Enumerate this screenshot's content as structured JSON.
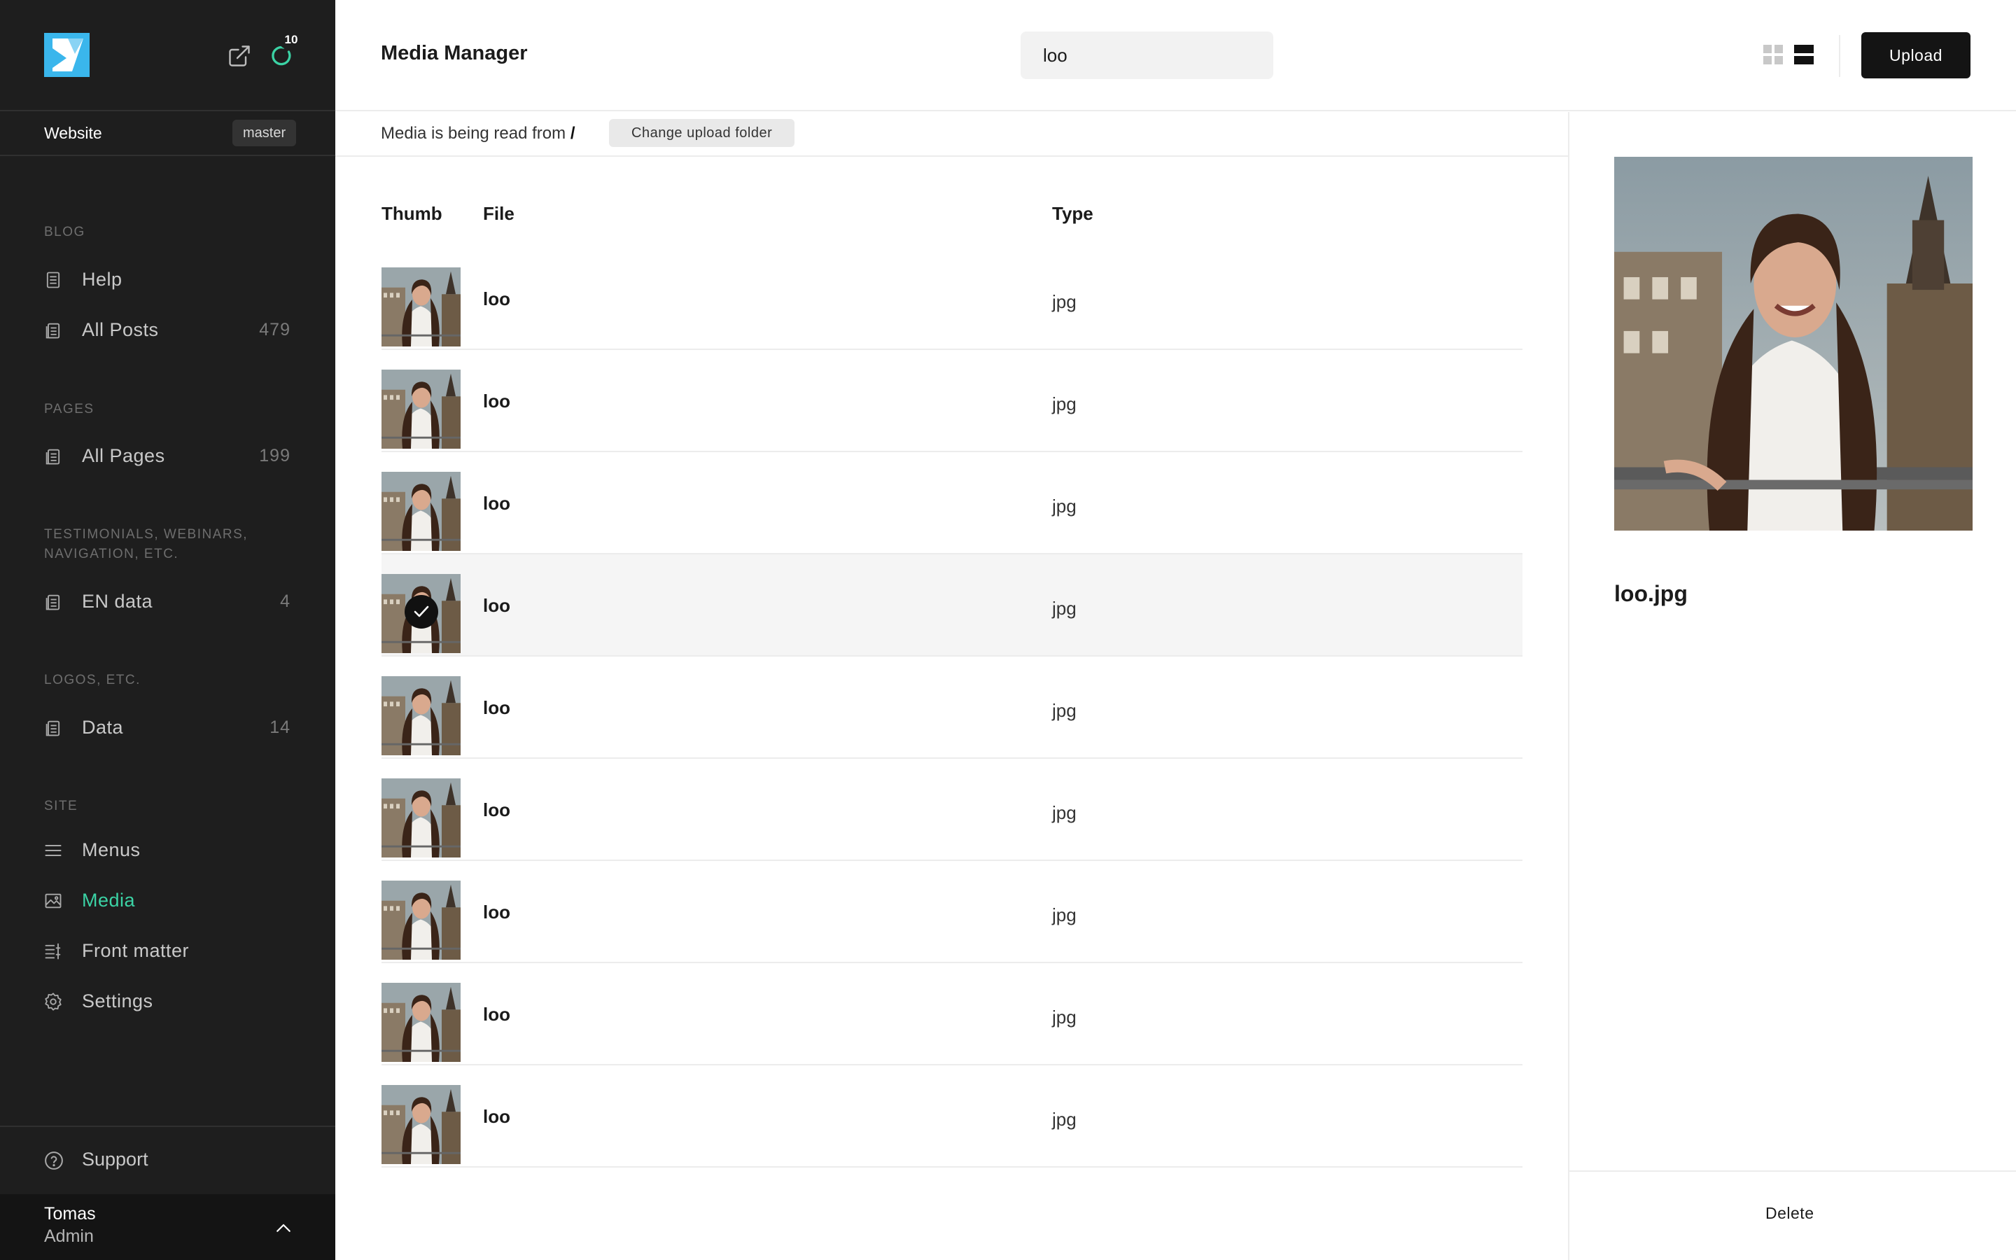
{
  "sidebar": {
    "sync_count": "10",
    "site_name": "Website",
    "branch": "master",
    "sections": [
      {
        "title": "BLOG",
        "items": [
          {
            "label": "Help",
            "count": "",
            "icon": "document-icon"
          },
          {
            "label": "All Posts",
            "count": "479",
            "icon": "documents-icon"
          }
        ]
      },
      {
        "title": "PAGES",
        "items": [
          {
            "label": "All Pages",
            "count": "199",
            "icon": "documents-icon"
          }
        ]
      },
      {
        "title": "TESTIMONIALS, WEBINARS, NAVIGATION, ETC.",
        "items": [
          {
            "label": "EN data",
            "count": "4",
            "icon": "documents-icon"
          }
        ]
      },
      {
        "title": "LOGOS, ETC.",
        "items": [
          {
            "label": "Data",
            "count": "14",
            "icon": "documents-icon"
          }
        ]
      },
      {
        "title": "SITE",
        "items": [
          {
            "label": "Menus",
            "icon": "menu-icon"
          },
          {
            "label": "Media",
            "icon": "image-icon",
            "active": true
          },
          {
            "label": "Front matter",
            "icon": "sliders-icon"
          },
          {
            "label": "Settings",
            "icon": "gear-icon"
          }
        ]
      }
    ],
    "support_label": "Support",
    "user": {
      "name": "Tomas",
      "role": "Admin"
    }
  },
  "header": {
    "title": "Media Manager",
    "search_value": "loo",
    "upload_label": "Upload"
  },
  "pathbar": {
    "prefix": "Media is being read from",
    "path": "/",
    "change_label": "Change upload folder"
  },
  "table": {
    "columns": {
      "thumb": "Thumb",
      "file": "File",
      "type": "Type"
    },
    "rows": [
      {
        "file": "loo",
        "type": "jpg"
      },
      {
        "file": "loo",
        "type": "jpg"
      },
      {
        "file": "loo",
        "type": "jpg"
      },
      {
        "file": "loo",
        "type": "jpg",
        "selected": true
      },
      {
        "file": "loo",
        "type": "jpg"
      },
      {
        "file": "loo",
        "type": "jpg"
      },
      {
        "file": "loo",
        "type": "jpg"
      },
      {
        "file": "loo",
        "type": "jpg"
      },
      {
        "file": "loo",
        "type": "jpg"
      }
    ]
  },
  "details": {
    "filename": "loo.jpg",
    "delete_label": "Delete"
  },
  "colors": {
    "sidebar_bg": "#1e1e1e",
    "accent": "#3bd3a5",
    "logo": "#3ab6ec",
    "button_dark": "#141414"
  }
}
